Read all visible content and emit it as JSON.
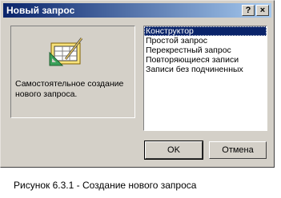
{
  "window": {
    "title": "Новый запрос",
    "help_button": "?",
    "close_button": "×"
  },
  "left_pane": {
    "icon": "query-design-icon",
    "description": "Самостоятельное создание нового запроса."
  },
  "query_types": [
    {
      "label": "Конструктор",
      "selected": true
    },
    {
      "label": "Простой запрос",
      "selected": false
    },
    {
      "label": "Перекрестный запрос",
      "selected": false
    },
    {
      "label": "Повторяющиеся записи",
      "selected": false
    },
    {
      "label": "Записи без подчиненных",
      "selected": false
    }
  ],
  "buttons": {
    "ok": "OK",
    "cancel": "Отмена"
  },
  "caption": "Рисунок 6.3.1 - Создание нового запроса",
  "colors": {
    "titlebar_start": "#0a246a",
    "titlebar_end": "#a6caf0",
    "dialog_face": "#d4d0c8",
    "selection": "#0a246a"
  }
}
